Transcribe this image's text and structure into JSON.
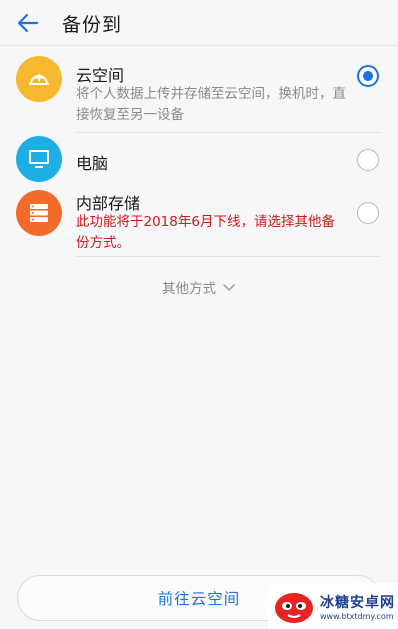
{
  "header": {
    "title": "备份到",
    "back_icon": "arrow-left-icon"
  },
  "options": [
    {
      "title": "云空间",
      "desc": "将个人数据上传并存储至云空间，换机时，直接恢复至另一设备",
      "icon": "cloud-sync-icon",
      "icon_color": "#f5b82e",
      "selected": true
    },
    {
      "title": "电脑",
      "icon": "monitor-icon",
      "icon_color": "#1eaee6",
      "selected": false
    },
    {
      "title": "内部存储",
      "warning": "此功能将于2018年6月下线，请选择其他备份方式。",
      "icon": "storage-icon",
      "icon_color": "#f26b2a",
      "selected": false
    }
  ],
  "other_methods": {
    "label": "其他方式"
  },
  "bottom_button": {
    "label": "前往云空间"
  },
  "watermark": {
    "name": "冰糖安卓网",
    "url": "www.btxtdmy.com"
  },
  "colors": {
    "accent": "#1a73e8",
    "warning": "#d01818"
  }
}
